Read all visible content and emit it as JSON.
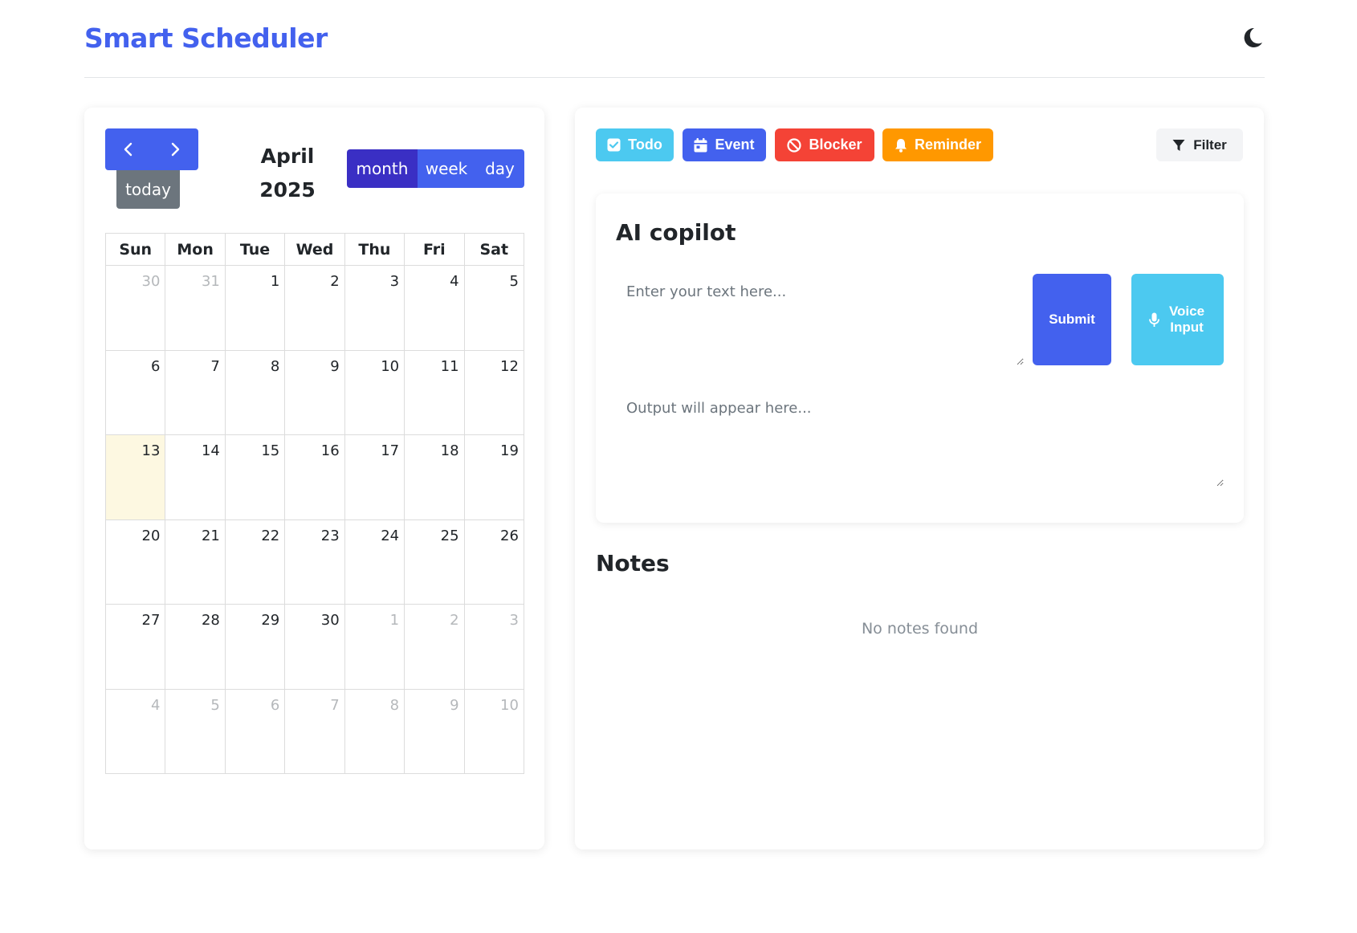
{
  "header": {
    "title": "Smart Scheduler",
    "theme_icon": "moon-icon"
  },
  "calendar": {
    "title_line1": "April",
    "title_line2": "2025",
    "today_label": "today",
    "views": [
      {
        "label": "month",
        "active": true
      },
      {
        "label": "week",
        "active": false
      },
      {
        "label": "day",
        "active": false
      }
    ],
    "weekdays": [
      "Sun",
      "Mon",
      "Tue",
      "Wed",
      "Thu",
      "Fri",
      "Sat"
    ],
    "weeks": [
      [
        {
          "d": "30",
          "other": true
        },
        {
          "d": "31",
          "other": true
        },
        {
          "d": "1"
        },
        {
          "d": "2"
        },
        {
          "d": "3"
        },
        {
          "d": "4"
        },
        {
          "d": "5"
        }
      ],
      [
        {
          "d": "6"
        },
        {
          "d": "7"
        },
        {
          "d": "8"
        },
        {
          "d": "9"
        },
        {
          "d": "10"
        },
        {
          "d": "11"
        },
        {
          "d": "12"
        }
      ],
      [
        {
          "d": "13",
          "today": true
        },
        {
          "d": "14"
        },
        {
          "d": "15"
        },
        {
          "d": "16"
        },
        {
          "d": "17"
        },
        {
          "d": "18"
        },
        {
          "d": "19"
        }
      ],
      [
        {
          "d": "20"
        },
        {
          "d": "21"
        },
        {
          "d": "22"
        },
        {
          "d": "23"
        },
        {
          "d": "24"
        },
        {
          "d": "25"
        },
        {
          "d": "26"
        }
      ],
      [
        {
          "d": "27"
        },
        {
          "d": "28"
        },
        {
          "d": "29"
        },
        {
          "d": "30"
        },
        {
          "d": "1",
          "other": true
        },
        {
          "d": "2",
          "other": true
        },
        {
          "d": "3",
          "other": true
        }
      ],
      [
        {
          "d": "4",
          "other": true
        },
        {
          "d": "5",
          "other": true
        },
        {
          "d": "6",
          "other": true
        },
        {
          "d": "7",
          "other": true
        },
        {
          "d": "8",
          "other": true
        },
        {
          "d": "9",
          "other": true
        },
        {
          "d": "10",
          "other": true
        }
      ]
    ]
  },
  "types": {
    "todo": "Todo",
    "event": "Event",
    "blocker": "Blocker",
    "reminder": "Reminder"
  },
  "filter": {
    "label": "Filter"
  },
  "copilot": {
    "title": "AI copilot",
    "input_placeholder": "Enter your text here...",
    "submit_label": "Submit",
    "voice_label": "Voice Input",
    "output_placeholder": "Output will appear here..."
  },
  "notes": {
    "title": "Notes",
    "empty_text": "No notes found"
  },
  "colors": {
    "brand": "#4361ee",
    "todo": "#4cc9f0",
    "event": "#4361ee",
    "blocker": "#f44336",
    "reminder": "#ff9800",
    "today_highlight": "#fdf8e1"
  }
}
